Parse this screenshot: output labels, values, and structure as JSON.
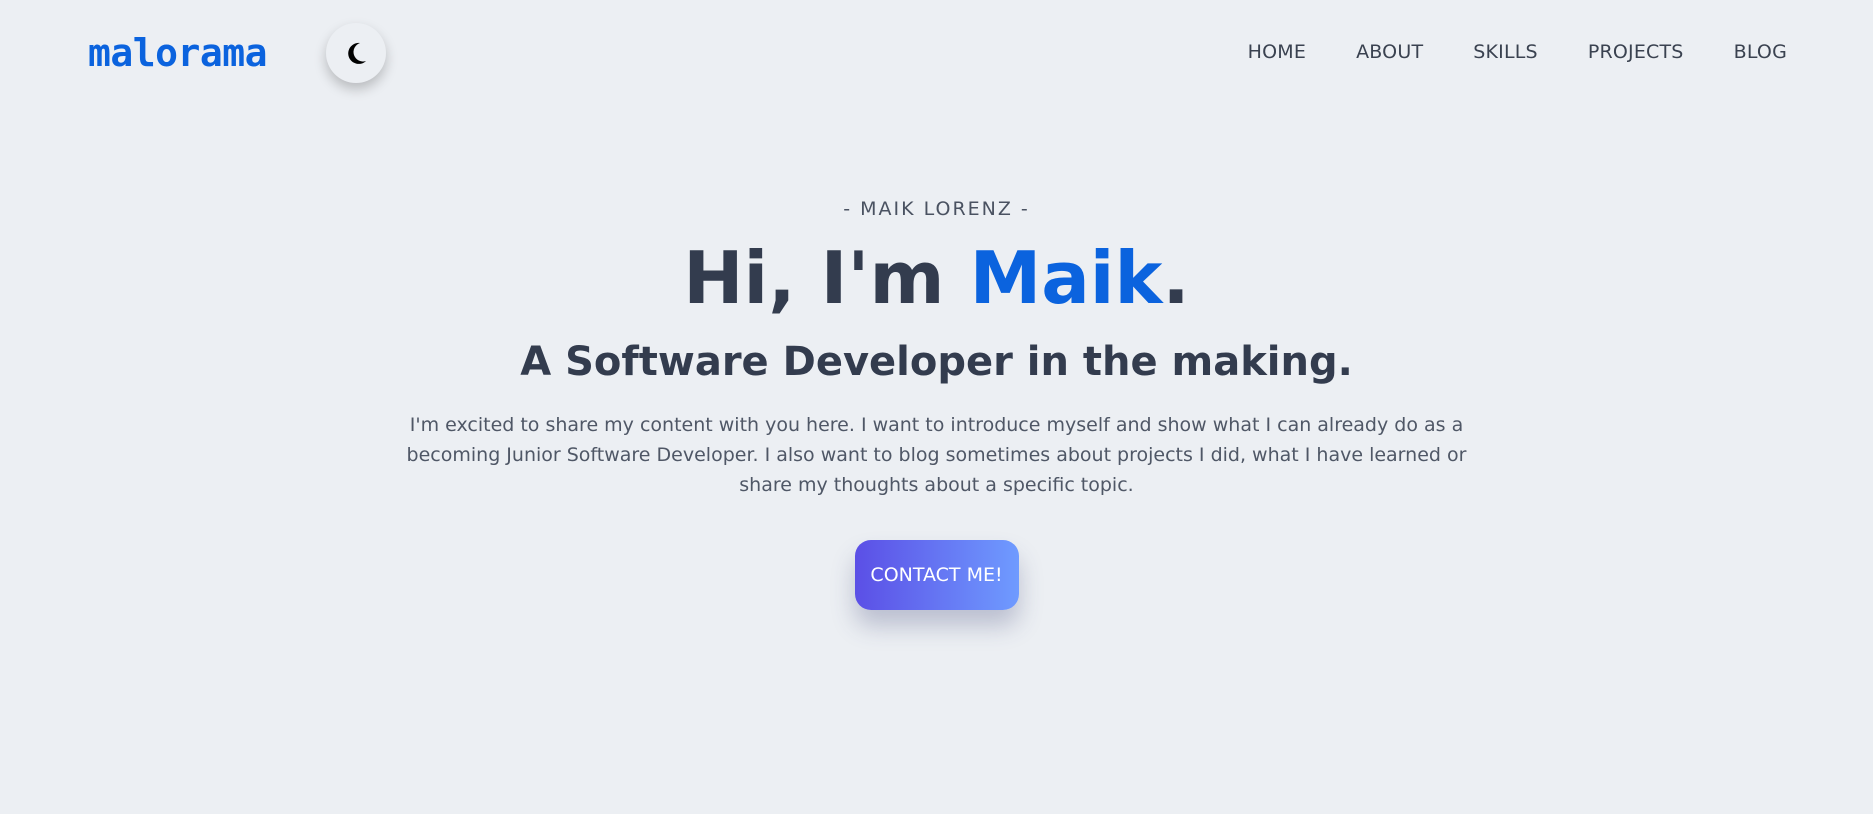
{
  "header": {
    "logo_text": "malorama",
    "theme_toggle_icon": "moon-icon",
    "nav": [
      {
        "label": "HOME"
      },
      {
        "label": "ABOUT"
      },
      {
        "label": "SKILLS"
      },
      {
        "label": "PROJECTS"
      },
      {
        "label": "BLOG"
      }
    ]
  },
  "hero": {
    "eyebrow": "- MAIK LORENZ -",
    "headline_prefix": "Hi, I'm ",
    "headline_name": "Maik",
    "headline_suffix": ".",
    "subheadline": "A Software Developer in the making.",
    "intro": "I'm excited to share my content with you here. I want to introduce myself and show what I can already do as a becoming Junior Software Developer. I also want to blog sometimes about projects I did, what I have learned or share my thoughts about a specific topic.",
    "cta_label": "CONTACT ME!"
  },
  "colors": {
    "background": "#eceff3",
    "accent": "#0b63de",
    "text_dark": "#333c4e",
    "cta_gradient_start": "#5b4fe6",
    "cta_gradient_end": "#6f9bff"
  }
}
